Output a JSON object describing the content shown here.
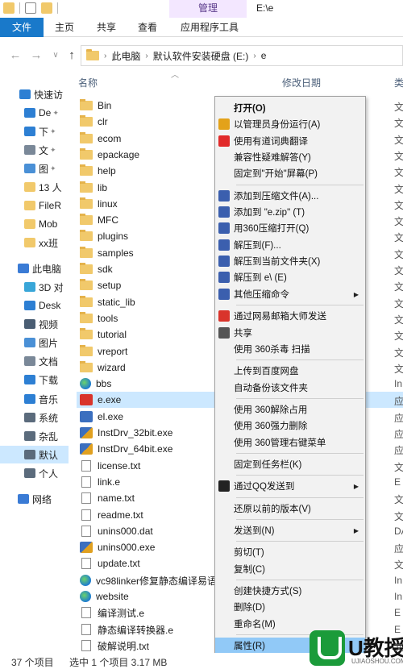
{
  "titlebar": {
    "context_tab": "管理",
    "path": "E:\\e"
  },
  "ribbon": {
    "tabs": [
      "文件",
      "主页",
      "共享",
      "查看",
      "应用程序工具"
    ]
  },
  "address": {
    "crumbs": [
      "此电脑",
      "默认软件安装硬盘 (E:)",
      "e"
    ]
  },
  "columns": {
    "name": "名称",
    "date": "修改日期",
    "type": "类"
  },
  "navpane": {
    "items": [
      {
        "label": "快速访",
        "icon": "star-icon",
        "color": "#2d7fd3"
      },
      {
        "label": "De",
        "icon": "desktop-icon",
        "color": "#2d7fd3"
      },
      {
        "label": "下",
        "icon": "download-icon",
        "color": "#2d7fd3"
      },
      {
        "label": "文",
        "icon": "document-icon",
        "color": "#7a8898"
      },
      {
        "label": "图",
        "icon": "picture-icon",
        "color": "#4a90d6"
      },
      {
        "label": "13 人",
        "icon": "folder-icon",
        "color": "#f1c96b"
      },
      {
        "label": "FileR",
        "icon": "folder-icon",
        "color": "#f1c96b"
      },
      {
        "label": "Mob",
        "icon": "folder-icon",
        "color": "#f1c96b"
      },
      {
        "label": "xx班",
        "icon": "folder-icon",
        "color": "#f1c96b"
      },
      {
        "label": "此电脑",
        "icon": "computer-icon",
        "color": "#3a7bd5"
      },
      {
        "label": "3D 对",
        "icon": "3d-objects-icon",
        "color": "#39a6d8"
      },
      {
        "label": "Desk",
        "icon": "desktop-icon",
        "color": "#2d7fd3"
      },
      {
        "label": "视频",
        "icon": "video-icon",
        "color": "#4a5d73"
      },
      {
        "label": "图片",
        "icon": "picture-icon",
        "color": "#4a90d6"
      },
      {
        "label": "文档",
        "icon": "document-icon",
        "color": "#7a8898"
      },
      {
        "label": "下载",
        "icon": "download-icon",
        "color": "#2d7fd3"
      },
      {
        "label": "音乐",
        "icon": "music-icon",
        "color": "#2d7fd3"
      },
      {
        "label": "系统",
        "icon": "drive-icon",
        "color": "#5b6b7c"
      },
      {
        "label": "杂乱",
        "icon": "drive-icon",
        "color": "#5b6b7c"
      },
      {
        "label": "默认",
        "icon": "drive-icon",
        "color": "#5b6b7c"
      },
      {
        "label": "个人",
        "icon": "drive-icon",
        "color": "#5b6b7c"
      },
      {
        "label": "网络",
        "icon": "network-icon",
        "color": "#3a7bd5"
      }
    ]
  },
  "files": [
    {
      "name": "Bin",
      "type": "folder",
      "kind": "文"
    },
    {
      "name": "clr",
      "type": "folder",
      "kind": "文"
    },
    {
      "name": "ecom",
      "type": "folder",
      "kind": "文"
    },
    {
      "name": "epackage",
      "type": "folder",
      "kind": "文"
    },
    {
      "name": "help",
      "type": "folder",
      "kind": "文"
    },
    {
      "name": "lib",
      "type": "folder",
      "kind": "文"
    },
    {
      "name": "linux",
      "type": "folder",
      "kind": "文"
    },
    {
      "name": "MFC",
      "type": "folder",
      "kind": "文"
    },
    {
      "name": "plugins",
      "type": "folder",
      "kind": "文"
    },
    {
      "name": "samples",
      "type": "folder",
      "kind": "文"
    },
    {
      "name": "sdk",
      "type": "folder",
      "kind": "文"
    },
    {
      "name": "setup",
      "type": "folder",
      "kind": "文"
    },
    {
      "name": "static_lib",
      "type": "folder",
      "kind": "文"
    },
    {
      "name": "tools",
      "type": "folder",
      "kind": "文"
    },
    {
      "name": "tutorial",
      "type": "folder",
      "kind": "文"
    },
    {
      "name": "vreport",
      "type": "folder",
      "kind": "文"
    },
    {
      "name": "wizard",
      "type": "folder",
      "kind": "文"
    },
    {
      "name": "bbs",
      "type": "globe",
      "kind": "In"
    },
    {
      "name": "e.exe",
      "type": "exe-red",
      "kind": "应"
    },
    {
      "name": "el.exe",
      "type": "exe",
      "kind": "应"
    },
    {
      "name": "InstDrv_32bit.exe",
      "type": "setup",
      "kind": "应"
    },
    {
      "name": "InstDrv_64bit.exe",
      "type": "setup",
      "kind": "应"
    },
    {
      "name": "license.txt",
      "type": "doc",
      "kind": "文"
    },
    {
      "name": "link.e",
      "type": "doc",
      "kind": "E"
    },
    {
      "name": "name.txt",
      "type": "doc",
      "kind": "文"
    },
    {
      "name": "readme.txt",
      "type": "doc",
      "kind": "文"
    },
    {
      "name": "unins000.dat",
      "type": "doc",
      "kind": "DA"
    },
    {
      "name": "unins000.exe",
      "type": "setup",
      "kind": "应"
    },
    {
      "name": "update.txt",
      "type": "doc",
      "kind": "文"
    },
    {
      "name": "vc98linker修复静态编译易语",
      "type": "globe",
      "kind": "In"
    },
    {
      "name": "website",
      "type": "globe",
      "kind": "In"
    },
    {
      "name": "编译测试.e",
      "type": "doc",
      "kind": "E"
    },
    {
      "name": "静态编译转换器.e",
      "type": "doc",
      "kind": "E"
    },
    {
      "name": "破解说明.txt",
      "type": "doc",
      "kind": "文"
    }
  ],
  "context_menu": {
    "groups": [
      [
        {
          "label": "打开(O)",
          "icon": "none",
          "bold": true
        },
        {
          "label": "以管理员身份运行(A)",
          "icon": "shield-icon",
          "color": "#e3a21a"
        },
        {
          "label": "使用有道词典翻译",
          "icon": "youdao-icon",
          "color": "#e12a2a"
        },
        {
          "label": "兼容性疑难解答(Y)",
          "icon": "none"
        },
        {
          "label": "固定到\"开始\"屏幕(P)",
          "icon": "none"
        }
      ],
      [
        {
          "label": "添加到压缩文件(A)...",
          "icon": "archive-icon",
          "color": "#3b5fae"
        },
        {
          "label": "添加到 \"e.zip\" (T)",
          "icon": "archive-icon",
          "color": "#3b5fae"
        },
        {
          "label": "用360压缩打开(Q)",
          "icon": "archive-icon",
          "color": "#3b5fae"
        },
        {
          "label": "解压到(F)...",
          "icon": "archive-icon",
          "color": "#3b5fae"
        },
        {
          "label": "解压到当前文件夹(X)",
          "icon": "archive-icon",
          "color": "#3b5fae"
        },
        {
          "label": "解压到 e\\ (E)",
          "icon": "archive-icon",
          "color": "#3b5fae"
        },
        {
          "label": "其他压缩命令",
          "icon": "archive-icon",
          "color": "#3b5fae",
          "submenu": true
        }
      ],
      [
        {
          "label": "通过网易邮箱大师发送",
          "icon": "mail-icon",
          "color": "#d9342b"
        },
        {
          "label": "共享",
          "icon": "share-icon",
          "color": "#555555"
        },
        {
          "label": "使用 360杀毒 扫描",
          "icon": "none"
        }
      ],
      [
        {
          "label": "上传到百度网盘",
          "icon": "none"
        },
        {
          "label": "自动备份该文件夹",
          "icon": "none"
        }
      ],
      [
        {
          "label": "使用 360解除占用",
          "icon": "none"
        },
        {
          "label": "使用 360强力删除",
          "icon": "none"
        },
        {
          "label": "使用 360管理右键菜单",
          "icon": "none"
        }
      ],
      [
        {
          "label": "固定到任务栏(K)",
          "icon": "none"
        }
      ],
      [
        {
          "label": "通过QQ发送到",
          "icon": "qq-icon",
          "color": "#222222",
          "submenu": true
        }
      ],
      [
        {
          "label": "还原以前的版本(V)",
          "icon": "none"
        }
      ],
      [
        {
          "label": "发送到(N)",
          "icon": "none",
          "submenu": true
        }
      ],
      [
        {
          "label": "剪切(T)",
          "icon": "none"
        },
        {
          "label": "复制(C)",
          "icon": "none"
        }
      ],
      [
        {
          "label": "创建快捷方式(S)",
          "icon": "none"
        },
        {
          "label": "删除(D)",
          "icon": "none"
        },
        {
          "label": "重命名(M)",
          "icon": "none"
        }
      ],
      [
        {
          "label": "属性(R)",
          "icon": "none",
          "hover": true
        }
      ]
    ]
  },
  "statusbar": {
    "count": "37 个项目",
    "selection": "选中 1 个项目  3.17 MB"
  },
  "watermark": {
    "brand": "U教授",
    "url": "UJIAOSHOU.COM"
  },
  "colors": {
    "file_tab": "#1979ca",
    "selection": "#cce8ff",
    "menu_hover": "#91c9f7",
    "context_tab": "#f3e7ff"
  }
}
